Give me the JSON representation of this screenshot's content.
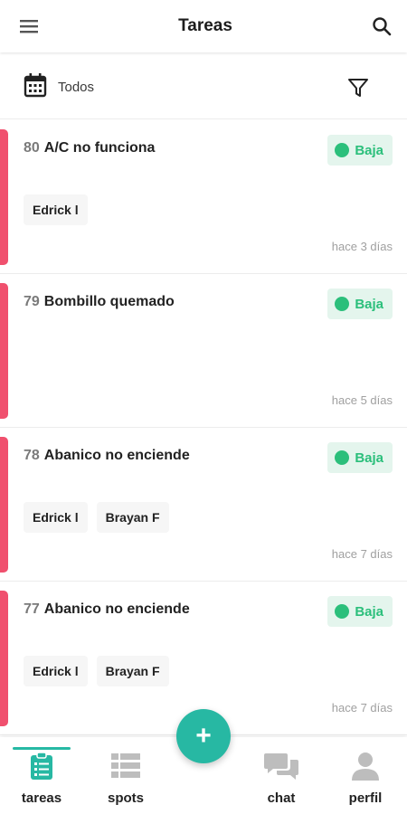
{
  "header": {
    "title": "Tareas",
    "menu_icon": "hamburger-menu-icon",
    "search_icon": "search-icon"
  },
  "filter": {
    "date_label": "Todos",
    "calendar_icon": "calendar-icon",
    "filter_icon": "funnel-filter-icon"
  },
  "colors": {
    "accent": "#27b8a3",
    "priority_low": "#2bbf7b",
    "priority_low_bg": "#e4f5ed",
    "card_stripe": "#f0506e"
  },
  "tasks": [
    {
      "id": "80",
      "title": "A/C no funciona",
      "priority": "Baja",
      "assignees": [
        "Edrick l"
      ],
      "time": "hace 3 días"
    },
    {
      "id": "79",
      "title": "Bombillo quemado",
      "priority": "Baja",
      "assignees": [],
      "time": "hace 5 días"
    },
    {
      "id": "78",
      "title": "Abanico no enciende",
      "priority": "Baja",
      "assignees": [
        "Edrick l",
        "Brayan F"
      ],
      "time": "hace 7 días"
    },
    {
      "id": "77",
      "title": "Abanico no enciende",
      "priority": "Baja",
      "assignees": [
        "Edrick l",
        "Brayan F"
      ],
      "time": "hace 7 días"
    }
  ],
  "fab": {
    "label": "+",
    "icon": "plus-icon"
  },
  "nav": {
    "items": [
      {
        "label": "tareas",
        "icon": "clipboard-icon",
        "active": true
      },
      {
        "label": "spots",
        "icon": "grid-list-icon",
        "active": false
      },
      {
        "label": "chat",
        "icon": "chat-bubbles-icon",
        "active": false
      },
      {
        "label": "perfil",
        "icon": "person-icon",
        "active": false
      }
    ]
  }
}
